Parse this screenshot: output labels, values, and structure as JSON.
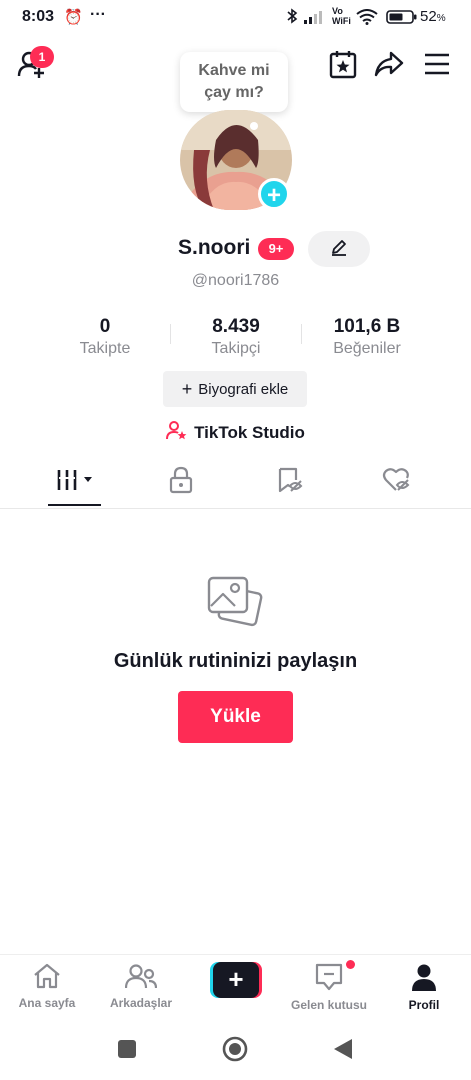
{
  "status_bar": {
    "time": "8:03",
    "alarm_icon": "alarm-icon",
    "more_dots": "···",
    "vo_wifi_top": "Vo",
    "vo_wifi_bottom": "WiFi",
    "battery_percent": "52",
    "battery_unit": "%"
  },
  "topbar": {
    "notification_count": "1"
  },
  "profile": {
    "status_bubble_line1": "Kahve mi",
    "status_bubble_line2": "çay mı?",
    "display_name": "S.noori",
    "name_badge": "9+",
    "handle": "@noori1786",
    "stats": [
      {
        "value": "0",
        "label": "Takipte"
      },
      {
        "value": "8.439",
        "label": "Takipçi"
      },
      {
        "value": "101,6 B",
        "label": "Beğeniler"
      }
    ],
    "bio_button_label": "Biyografi ekle",
    "bio_button_icon": "+",
    "studio_label": "TikTok Studio"
  },
  "empty_state": {
    "title": "Günlük rutininizi paylaşın",
    "upload_label": "Yükle"
  },
  "bottom_nav": {
    "home": "Ana sayfa",
    "friends": "Arkadaşlar",
    "create_icon": "+",
    "inbox": "Gelen kutusu",
    "profile": "Profil"
  },
  "colors": {
    "accent": "#fe2c55",
    "cyan": "#20d5ec",
    "text": "#161823",
    "muted": "#8a8b91"
  }
}
